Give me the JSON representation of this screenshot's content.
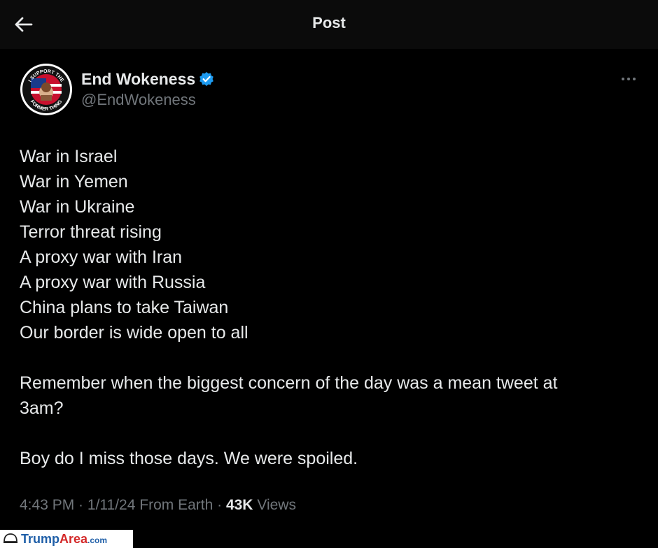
{
  "header": {
    "title": "Post",
    "back_icon": "arrow-left-icon"
  },
  "author": {
    "name": "End Wokeness",
    "handle": "@EndWokeness",
    "verified_color": "#1d9bf0",
    "avatar_text_top": "I SUPPORT THE",
    "avatar_text_bottom": "FORMER THING"
  },
  "tweet": {
    "lines": [
      "War in Israel",
      "War in Yemen",
      "War in Ukraine",
      "Terror threat rising",
      "A proxy war with Iran",
      "A proxy war with Russia",
      "China plans to take Taiwan",
      "Our border is wide open to all"
    ],
    "paragraph2_line1": "Remember when the biggest concern of the day was a mean tweet at",
    "paragraph2_line2": "3am?",
    "paragraph3": "Boy do I miss those days. We were spoiled."
  },
  "meta": {
    "time": "4:43 PM",
    "date": "1/11/24",
    "source": "From Earth",
    "views_count": "43K",
    "views_label": "Views"
  },
  "watermark": {
    "part1": "Trump",
    "part2": "Area",
    "part3": ".com"
  }
}
